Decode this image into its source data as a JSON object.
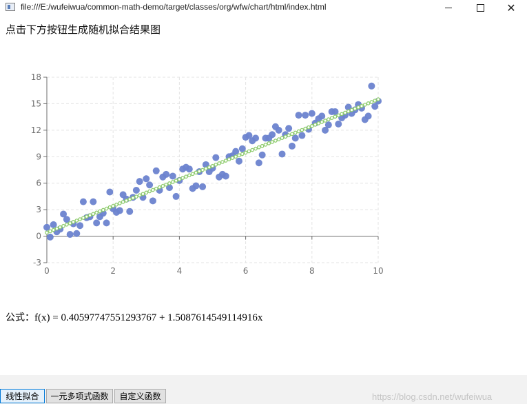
{
  "window": {
    "title": "file:///E:/wufeiwua/common-math-demo/target/classes/org/wfw/chart/html/index.html",
    "minimize_icon": "minimize-icon",
    "maximize_icon": "maximize-icon",
    "close_icon": "close-icon",
    "close_glyph": "✕"
  },
  "prompt": "点击下方按钮生成随机拟合结果图",
  "formula": {
    "label": "公式：",
    "expression": "f(x) = 0.40597747551293767 + 1.5087614549114916x"
  },
  "tabs": [
    {
      "label": "线性拟合",
      "active": true
    },
    {
      "label": "一元多项式函数",
      "active": false
    },
    {
      "label": "自定义函数",
      "active": false
    }
  ],
  "watermark": "https://blog.csdn.net/wufeiwua",
  "colors": {
    "scatter": "#6b83cf",
    "fit_line": "#8fcc6e",
    "axis": "#6e6e6e",
    "grid": "#e3e3e3"
  },
  "chart_data": {
    "type": "scatter",
    "xlim": [
      0,
      10
    ],
    "ylim": [
      -3,
      18
    ],
    "x_ticks": [
      "0",
      "2",
      "4",
      "6",
      "8",
      "10"
    ],
    "y_ticks": [
      "-3",
      "0",
      "3",
      "6",
      "9",
      "12",
      "15",
      "18"
    ],
    "grid": true,
    "series": [
      {
        "kind": "scatter",
        "points": [
          [
            0.0,
            1.0
          ],
          [
            0.1,
            -0.1
          ],
          [
            0.2,
            1.3
          ],
          [
            0.3,
            0.5
          ],
          [
            0.4,
            0.8
          ],
          [
            0.5,
            2.5
          ],
          [
            0.6,
            1.9
          ],
          [
            0.7,
            0.2
          ],
          [
            0.8,
            1.4
          ],
          [
            0.9,
            0.3
          ],
          [
            1.0,
            1.2
          ],
          [
            1.1,
            3.9
          ],
          [
            1.2,
            2.1
          ],
          [
            1.3,
            2.2
          ],
          [
            1.4,
            3.9
          ],
          [
            1.5,
            1.5
          ],
          [
            1.6,
            2.2
          ],
          [
            1.7,
            2.6
          ],
          [
            1.8,
            1.5
          ],
          [
            1.9,
            5.0
          ],
          [
            2.0,
            3.1
          ],
          [
            2.1,
            2.7
          ],
          [
            2.2,
            2.9
          ],
          [
            2.3,
            4.7
          ],
          [
            2.4,
            4.2
          ],
          [
            2.5,
            2.8
          ],
          [
            2.6,
            4.4
          ],
          [
            2.7,
            5.2
          ],
          [
            2.8,
            6.2
          ],
          [
            2.9,
            4.4
          ],
          [
            3.0,
            6.5
          ],
          [
            3.1,
            5.8
          ],
          [
            3.2,
            4.0
          ],
          [
            3.3,
            7.4
          ],
          [
            3.4,
            5.2
          ],
          [
            3.5,
            6.7
          ],
          [
            3.6,
            7.0
          ],
          [
            3.7,
            5.5
          ],
          [
            3.8,
            6.8
          ],
          [
            3.9,
            4.5
          ],
          [
            4.0,
            6.3
          ],
          [
            4.1,
            7.6
          ],
          [
            4.2,
            7.8
          ],
          [
            4.3,
            7.6
          ],
          [
            4.4,
            5.4
          ],
          [
            4.5,
            5.7
          ],
          [
            4.6,
            7.3
          ],
          [
            4.7,
            5.6
          ],
          [
            4.8,
            8.1
          ],
          [
            4.9,
            7.3
          ],
          [
            5.0,
            7.7
          ],
          [
            5.1,
            8.9
          ],
          [
            5.2,
            6.7
          ],
          [
            5.3,
            7.0
          ],
          [
            5.4,
            6.8
          ],
          [
            5.5,
            9.0
          ],
          [
            5.6,
            9.1
          ],
          [
            5.7,
            9.6
          ],
          [
            5.8,
            8.5
          ],
          [
            5.9,
            9.9
          ],
          [
            6.0,
            11.2
          ],
          [
            6.1,
            11.4
          ],
          [
            6.2,
            10.8
          ],
          [
            6.3,
            11.1
          ],
          [
            6.4,
            8.3
          ],
          [
            6.5,
            9.2
          ],
          [
            6.6,
            11.1
          ],
          [
            6.7,
            11.1
          ],
          [
            6.8,
            11.5
          ],
          [
            6.9,
            12.4
          ],
          [
            7.0,
            12.0
          ],
          [
            7.1,
            9.3
          ],
          [
            7.2,
            11.5
          ],
          [
            7.3,
            12.2
          ],
          [
            7.4,
            10.2
          ],
          [
            7.5,
            11.1
          ],
          [
            7.6,
            13.7
          ],
          [
            7.7,
            11.4
          ],
          [
            7.8,
            13.7
          ],
          [
            7.9,
            12.1
          ],
          [
            8.0,
            13.9
          ],
          [
            8.1,
            12.8
          ],
          [
            8.2,
            13.3
          ],
          [
            8.3,
            13.6
          ],
          [
            8.4,
            12.0
          ],
          [
            8.5,
            12.6
          ],
          [
            8.6,
            14.1
          ],
          [
            8.7,
            14.1
          ],
          [
            8.8,
            12.7
          ],
          [
            8.9,
            13.4
          ],
          [
            9.0,
            13.7
          ],
          [
            9.1,
            14.6
          ],
          [
            9.2,
            13.9
          ],
          [
            9.3,
            14.3
          ],
          [
            9.4,
            14.9
          ],
          [
            9.5,
            14.5
          ],
          [
            9.6,
            13.2
          ],
          [
            9.7,
            13.6
          ],
          [
            9.8,
            17.0
          ],
          [
            9.9,
            14.7
          ],
          [
            10.0,
            15.3
          ]
        ]
      },
      {
        "kind": "line",
        "intercept": 0.40597747551293767,
        "slope": 1.5087614549114916,
        "step": 0.1
      }
    ]
  }
}
